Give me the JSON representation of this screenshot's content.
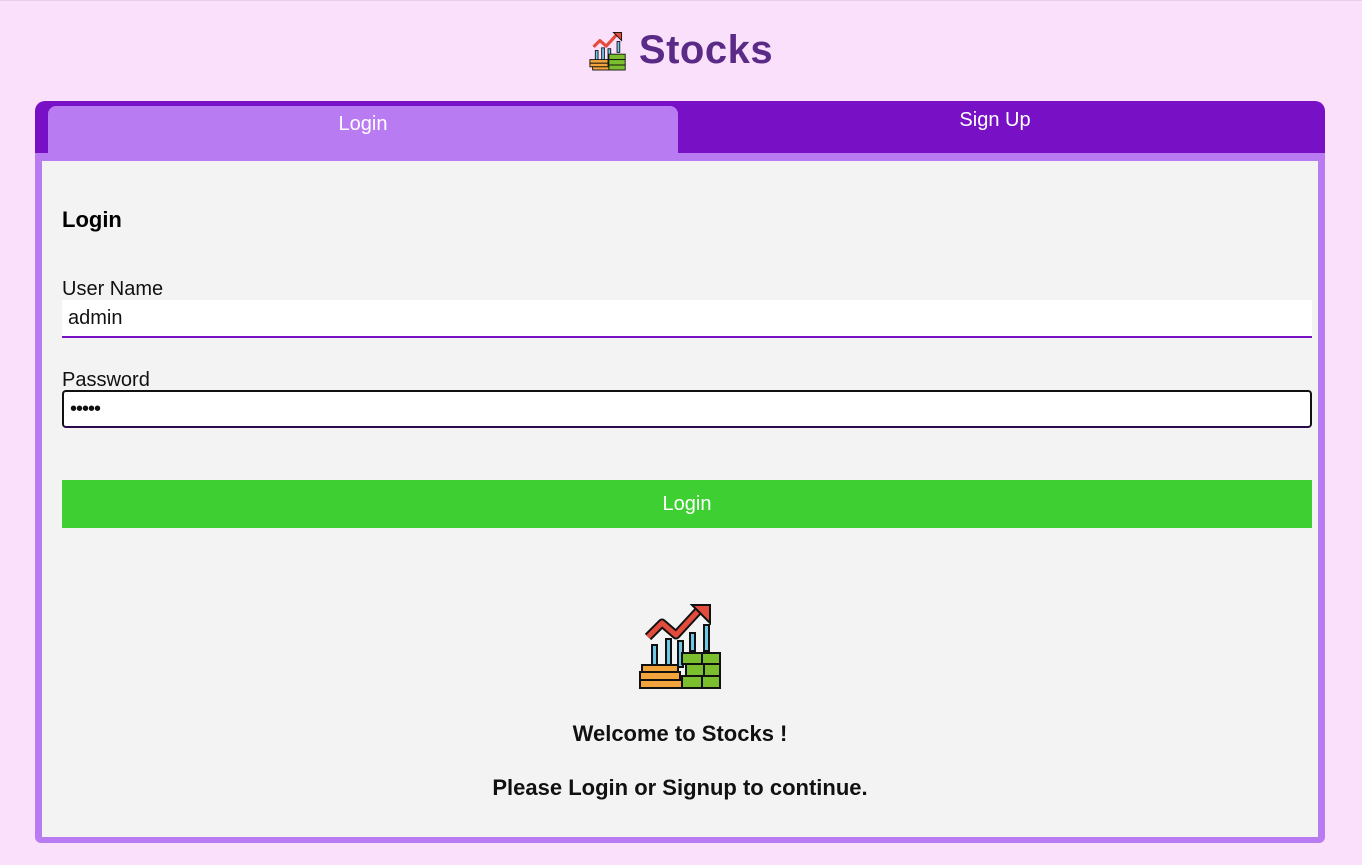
{
  "header": {
    "title": "Stocks",
    "logo_icon": "stocks-chart-coins-icon"
  },
  "tabs": [
    {
      "label": "Login",
      "active": true
    },
    {
      "label": "Sign Up",
      "active": false
    }
  ],
  "login_form": {
    "heading": "Login",
    "username_label": "User Name",
    "username_value": "admin",
    "password_label": "Password",
    "password_value": "•••••",
    "submit_label": "Login"
  },
  "welcome": {
    "icon": "stocks-chart-coins-icon",
    "line1": "Welcome to Stocks !",
    "line2": "Please Login or Signup to continue."
  },
  "colors": {
    "page_background": "#fbe0fc",
    "tab_bar": "#7811c6",
    "active_tab": "#b87bf2",
    "title": "#5a2b86",
    "login_button": "#3ecf32"
  }
}
